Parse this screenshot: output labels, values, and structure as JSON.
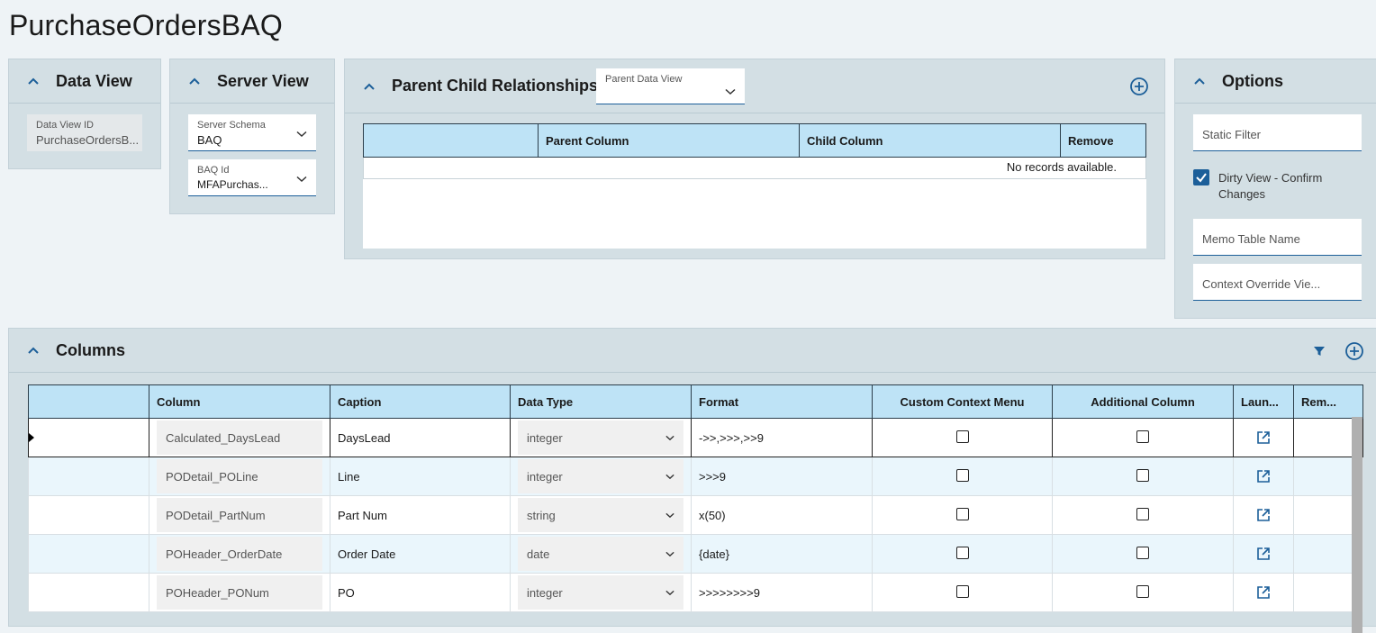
{
  "page": {
    "title": "PurchaseOrdersBAQ"
  },
  "data_view": {
    "title": "Data View",
    "fields": {
      "id_label": "Data View ID",
      "id_value": "PurchaseOrdersB..."
    }
  },
  "server_view": {
    "title": "Server View",
    "schema_label": "Server Schema",
    "schema_value": "BAQ",
    "baq_label": "BAQ Id",
    "baq_value": "MFAPurchas..."
  },
  "pcr": {
    "title": "Parent Child Relationships",
    "parent_dv_label": "Parent Data View",
    "columns": [
      "",
      "Parent Column",
      "Child Column",
      "Remove"
    ],
    "empty_text": "No records available."
  },
  "options": {
    "title": "Options",
    "static_filter": "Static Filter",
    "dirty_view_label": "Dirty View - Confirm",
    "dirty_view_label2": "Changes",
    "memo_table": "Memo Table Name",
    "context_override": "Context Override Vie..."
  },
  "columns_panel": {
    "title": "Columns",
    "headers": [
      "",
      "Column",
      "Caption",
      "Data Type",
      "Format",
      "Custom Context Menu",
      "Additional Column",
      "Laun...",
      "Rem..."
    ],
    "rows": [
      {
        "column": "Calculated_DaysLead",
        "caption": "DaysLead",
        "data_type": "integer",
        "format": "->>,>>>,>>9"
      },
      {
        "column": "PODetail_POLine",
        "caption": "Line",
        "data_type": "integer",
        "format": ">>>9"
      },
      {
        "column": "PODetail_PartNum",
        "caption": "Part Num",
        "data_type": "string",
        "format": "x(50)"
      },
      {
        "column": "POHeader_OrderDate",
        "caption": "Order Date",
        "data_type": "date",
        "format": "{date}"
      },
      {
        "column": "POHeader_PONum",
        "caption": "PO",
        "data_type": "integer",
        "format": ">>>>>>>>9"
      }
    ]
  },
  "colors": {
    "accent": "#1c5f99",
    "panel": "#d3dfe4",
    "header": "#bee3f6",
    "alt_row": "#eaf6fc"
  }
}
